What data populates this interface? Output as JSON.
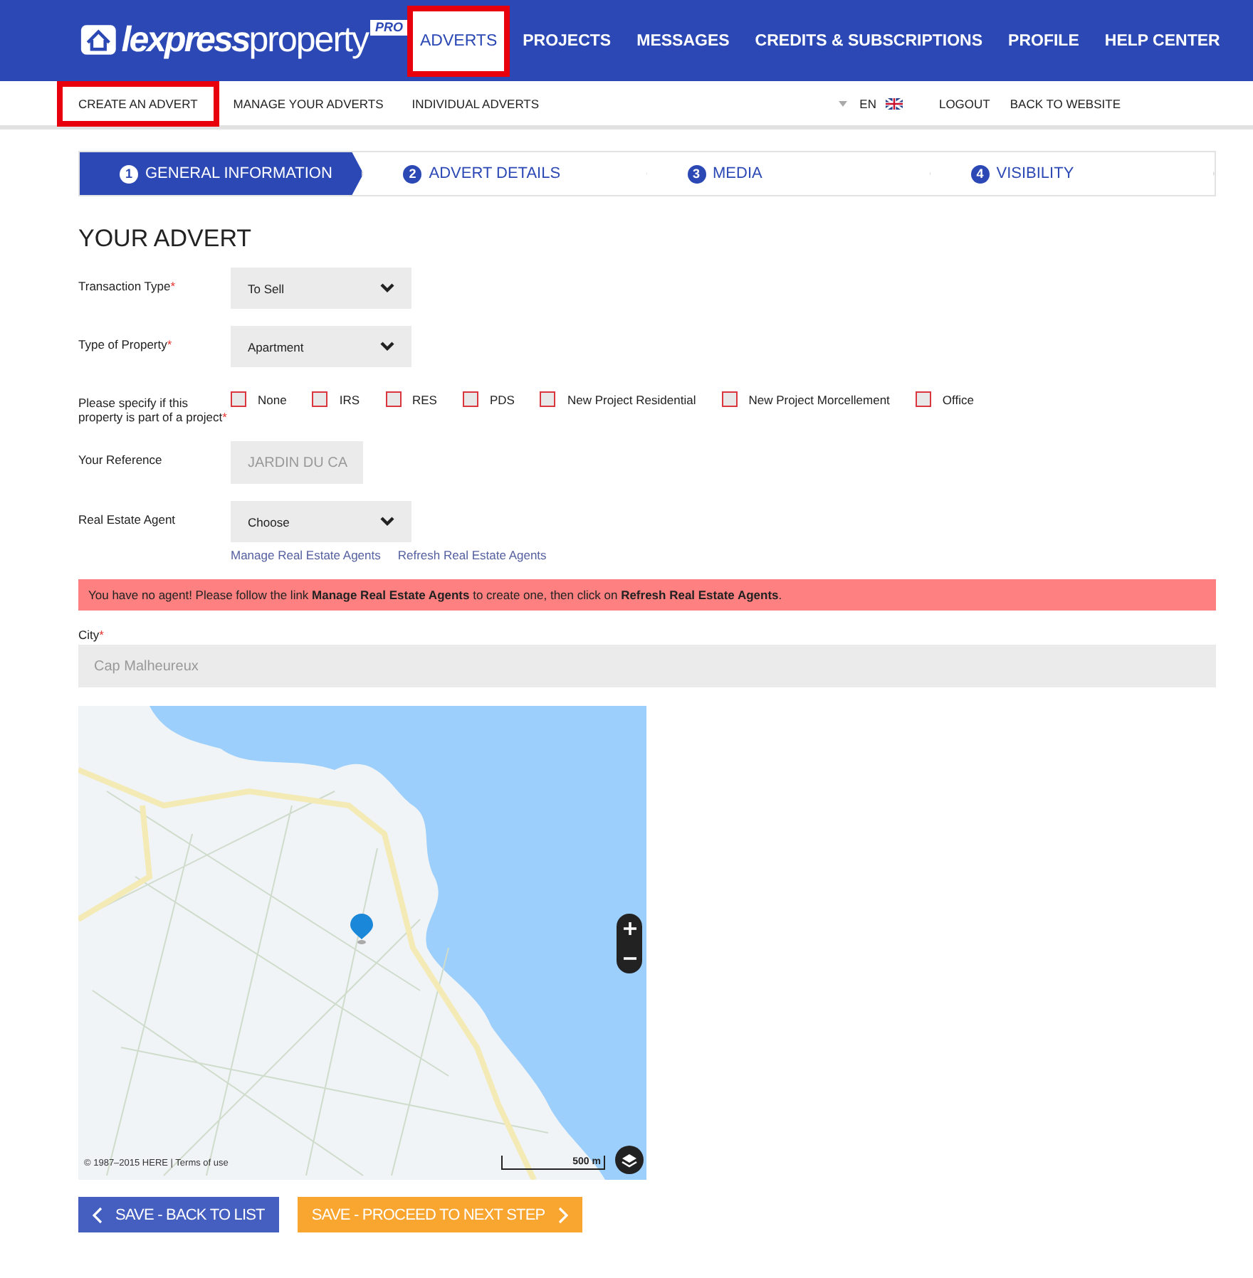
{
  "header": {
    "logo": {
      "part_1": "lexpress",
      "part_2": "property",
      "badge": "PRO"
    },
    "nav": [
      {
        "label": "ADVERTS",
        "selected": true,
        "highlighted": true
      },
      {
        "label": "PROJECTS",
        "selected": false,
        "highlighted": false
      },
      {
        "label": "MESSAGES",
        "selected": false,
        "highlighted": false
      },
      {
        "label": "CREDITS & SUBSCRIPTIONS",
        "selected": false,
        "highlighted": false
      },
      {
        "label": "PROFILE",
        "selected": false,
        "highlighted": false
      },
      {
        "label": "HELP CENTER",
        "selected": false,
        "highlighted": false
      }
    ]
  },
  "subnav": {
    "items": [
      {
        "label": "CREATE AN ADVERT",
        "highlighted": true
      },
      {
        "label": "MANAGE YOUR ADVERTS",
        "highlighted": false
      },
      {
        "label": "INDIVIDUAL ADVERTS",
        "highlighted": false
      }
    ],
    "language": "EN",
    "links": [
      "LOGOUT",
      "BACK TO WEBSITE"
    ]
  },
  "steps": [
    {
      "number": "1",
      "label": "GENERAL INFORMATION",
      "selected": true
    },
    {
      "number": "2",
      "label": "ADVERT DETAILS",
      "selected": false
    },
    {
      "number": "3",
      "label": "MEDIA",
      "selected": false
    },
    {
      "number": "4",
      "label": "VISIBILITY",
      "selected": false
    }
  ],
  "form": {
    "title": "YOUR ADVERT",
    "fields": [
      {
        "kind": "select",
        "label": "Transaction Type",
        "required_mark": "*",
        "value": "To Sell"
      },
      {
        "kind": "select",
        "label": "Type of Property",
        "required_mark": "*",
        "value": "Apartment"
      },
      {
        "kind": "checkboxes",
        "label": "Please specify if this property is part of a project",
        "required_mark": "*",
        "options": [
          {
            "label": "None",
            "checked": false
          },
          {
            "label": "IRS",
            "checked": false
          },
          {
            "label": "RES",
            "checked": false
          },
          {
            "label": "PDS",
            "checked": false
          },
          {
            "label": "New Project Residential",
            "checked": false
          },
          {
            "label": "New Project Morcellement",
            "checked": false
          },
          {
            "label": "Office",
            "checked": false
          }
        ]
      },
      {
        "kind": "text",
        "label": "Your Reference",
        "value": "JARDIN DU CA",
        "disabled": true
      },
      {
        "kind": "select",
        "label": "Real Estate Agent",
        "value": "Choose",
        "links": [
          "Manage Real Estate Agents",
          "Refresh Real Estate Agents"
        ]
      }
    ],
    "alert": "You have no agent! Please follow the link **Manage Real Estate Agents** to create one, then click on **Refresh Real Estate Agents**.",
    "city": {
      "label": "City",
      "required_mark": "*",
      "value": "Cap Malheureux",
      "disabled": true
    }
  },
  "map": {
    "scale": "500 m",
    "copyright": "© 1987–2015 HERE | Terms of use"
  },
  "buttons": [
    {
      "kind": "back",
      "label": "SAVE - BACK TO LIST"
    },
    {
      "kind": "next",
      "label": "SAVE - PROCEED TO NEXT STEP"
    }
  ]
}
